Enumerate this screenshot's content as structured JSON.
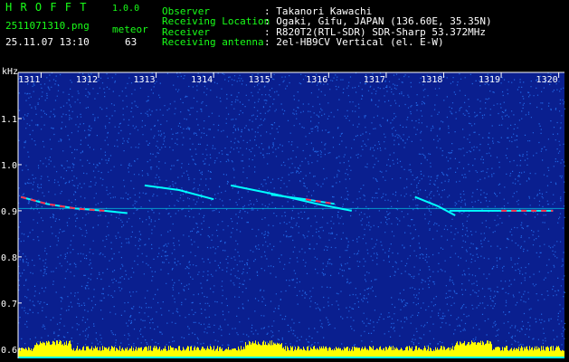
{
  "header": {
    "app_name": "H R O F F T",
    "version": "1.0.0",
    "filename": "2511071310.png",
    "datetime": "25.11.07 13:10",
    "mode": "meteor",
    "count": "63",
    "observer_label": "Observer",
    "observer_value": ": Takanori Kawachi",
    "location_label": "Receiving Location",
    "location_value": ": Ogaki, Gifu, JAPAN (136.60E, 35.35N)",
    "receiver_label": "Receiver",
    "receiver_value": ": R820T2(RTL-SDR) SDR-Sharp 53.372MHz",
    "antenna_label": "Receiving antenna",
    "antenna_value": ": 2el-HB9CV Vertical (el. E-W)"
  },
  "spectrogram": {
    "y_unit": "kHz",
    "y_ticks": [
      "1.1",
      "1.0",
      "0.9",
      "0.8",
      "0.7",
      "0.6"
    ],
    "y_tick_values": [
      1.1,
      1.0,
      0.9,
      0.8,
      0.7,
      0.6
    ],
    "y_range": [
      0.58,
      1.2
    ],
    "x_ticks": [
      "1311",
      "1312",
      "1313",
      "1314",
      "1315",
      "1316",
      "1317",
      "1318",
      "1319",
      "1320"
    ],
    "x_tick_values": [
      1311,
      1312,
      1313,
      1314,
      1315,
      1316,
      1317,
      1318,
      1319,
      1320
    ],
    "x_range": [
      1310.6,
      1320.1
    ],
    "echo_traces": [
      {
        "x": [
          1310.65,
          1311.1,
          1311.6,
          1312.1,
          1312.5
        ],
        "y": [
          0.93,
          0.915,
          0.905,
          0.9,
          0.895
        ]
      },
      {
        "x": [
          1312.8,
          1313.4,
          1314.0
        ],
        "y": [
          0.955,
          0.945,
          0.925
        ]
      },
      {
        "x": [
          1314.3,
          1315.1,
          1315.8,
          1316.4
        ],
        "y": [
          0.955,
          0.935,
          0.915,
          0.9
        ]
      },
      {
        "x": [
          1315.0,
          1315.6,
          1316.1
        ],
        "y": [
          0.935,
          0.925,
          0.915
        ]
      },
      {
        "x": [
          1317.5,
          1317.9,
          1318.2
        ],
        "y": [
          0.93,
          0.91,
          0.89
        ]
      },
      {
        "x": [
          1318.1,
          1319.0,
          1319.9
        ],
        "y": [
          0.9,
          0.9,
          0.9
        ]
      }
    ],
    "carrier_kHz": 0.905,
    "colors": {
      "background": "#0a1f8f",
      "noise": "#2a7fff",
      "echo": "#00ffff",
      "echo_core": "#ff3050",
      "axis": "#ffffff",
      "header_label": "#19ff19",
      "header_value": "#ffffff",
      "noise_floor": "#ffff00"
    }
  }
}
